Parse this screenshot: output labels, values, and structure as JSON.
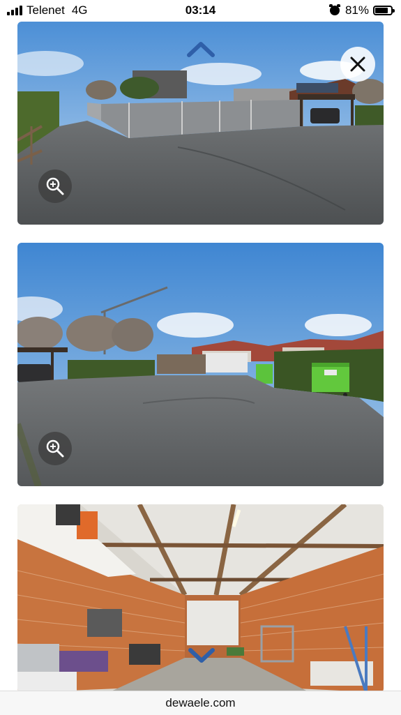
{
  "status_bar": {
    "carrier": "Telenet",
    "network": "4G",
    "time": "03:14",
    "battery_percent": "81%",
    "battery_level": 0.81,
    "icons": [
      "signal-icon",
      "alarm-icon",
      "battery-icon"
    ]
  },
  "gallery": {
    "photos": [
      {
        "name": "driveway-fence-carport",
        "has_zoom": true
      },
      {
        "name": "courtyard-containers",
        "has_zoom": true
      },
      {
        "name": "garage-interior",
        "has_zoom": false
      }
    ],
    "controls": {
      "close_icon": "close-icon",
      "up_icon": "chevron-up-icon",
      "down_icon": "chevron-down-icon",
      "zoom_icon": "zoom-in-icon"
    },
    "accent_color": "#2f5fa8"
  },
  "browser": {
    "url": "dewaele.com"
  }
}
